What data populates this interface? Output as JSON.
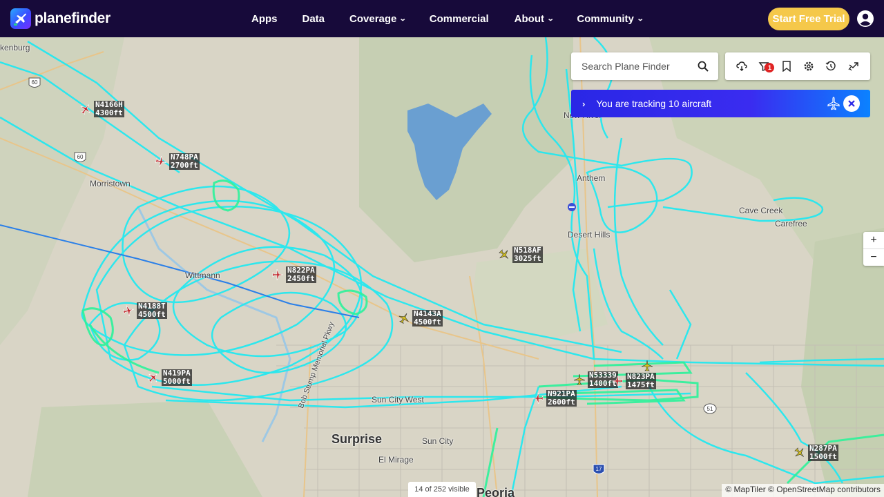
{
  "brand": {
    "name": "planefinder"
  },
  "nav": [
    {
      "label": "Apps",
      "dropdown": false
    },
    {
      "label": "Data",
      "dropdown": false
    },
    {
      "label": "Coverage",
      "dropdown": true
    },
    {
      "label": "Commercial",
      "dropdown": false
    },
    {
      "label": "About",
      "dropdown": true
    },
    {
      "label": "Community",
      "dropdown": true
    }
  ],
  "header": {
    "trial_label": "Start Free Trial"
  },
  "search": {
    "placeholder": "Search Plane Finder"
  },
  "tools": {
    "icons": [
      "weather-icon",
      "filter-icon",
      "bookmark-icon",
      "settings-icon",
      "history-icon",
      "layers-icon"
    ],
    "filter_badge": "1"
  },
  "tracking": {
    "text": "You are tracking 10 aircraft"
  },
  "zoom": {
    "in": "+",
    "out": "−"
  },
  "map": {
    "places": [
      {
        "name": "kenburg"
      },
      {
        "name": "Morristown"
      },
      {
        "name": "Wittmann"
      },
      {
        "name": "Anthem"
      },
      {
        "name": "New River"
      },
      {
        "name": "Desert Hills"
      },
      {
        "name": "Cave Creek"
      },
      {
        "name": "Carefree"
      },
      {
        "name": "Surprise"
      },
      {
        "name": "Sun City"
      },
      {
        "name": "El Mirage"
      },
      {
        "name": "Sun City West"
      },
      {
        "name": "Peoria"
      },
      {
        "name": "Bob Stump Memorial Pkwy"
      }
    ],
    "route_shields": [
      "60",
      "60",
      "51",
      "17"
    ]
  },
  "aircraft": [
    {
      "callsign": "N4166H",
      "altitude": "4300ft",
      "color": "#c0282d"
    },
    {
      "callsign": "N748PA",
      "altitude": "2700ft",
      "color": "#c0282d"
    },
    {
      "callsign": "N822PA",
      "altitude": "2450ft",
      "color": "#c0282d"
    },
    {
      "callsign": "N4188T",
      "altitude": "4500ft",
      "color": "#c0282d"
    },
    {
      "callsign": "N419PA",
      "altitude": "5000ft",
      "color": "#c0282d"
    },
    {
      "callsign": "N518AF",
      "altitude": "3025ft",
      "color": "#d6c21c"
    },
    {
      "callsign": "N4143A",
      "altitude": "4500ft",
      "color": "#d6c21c"
    },
    {
      "callsign": "N53339",
      "altitude": "1400ft",
      "color": "#d6c21c"
    },
    {
      "callsign": "N823PA",
      "altitude": "1475ft",
      "color": "#c0282d"
    },
    {
      "callsign": "N921PA",
      "altitude": "2600ft",
      "color": "#c0282d"
    },
    {
      "callsign": "N287PA",
      "altitude": "1500ft",
      "color": "#d6c21c"
    }
  ],
  "status": {
    "visible": "14 of 252 visible"
  },
  "attribution": "© MapTiler © OpenStreetMap contributors"
}
